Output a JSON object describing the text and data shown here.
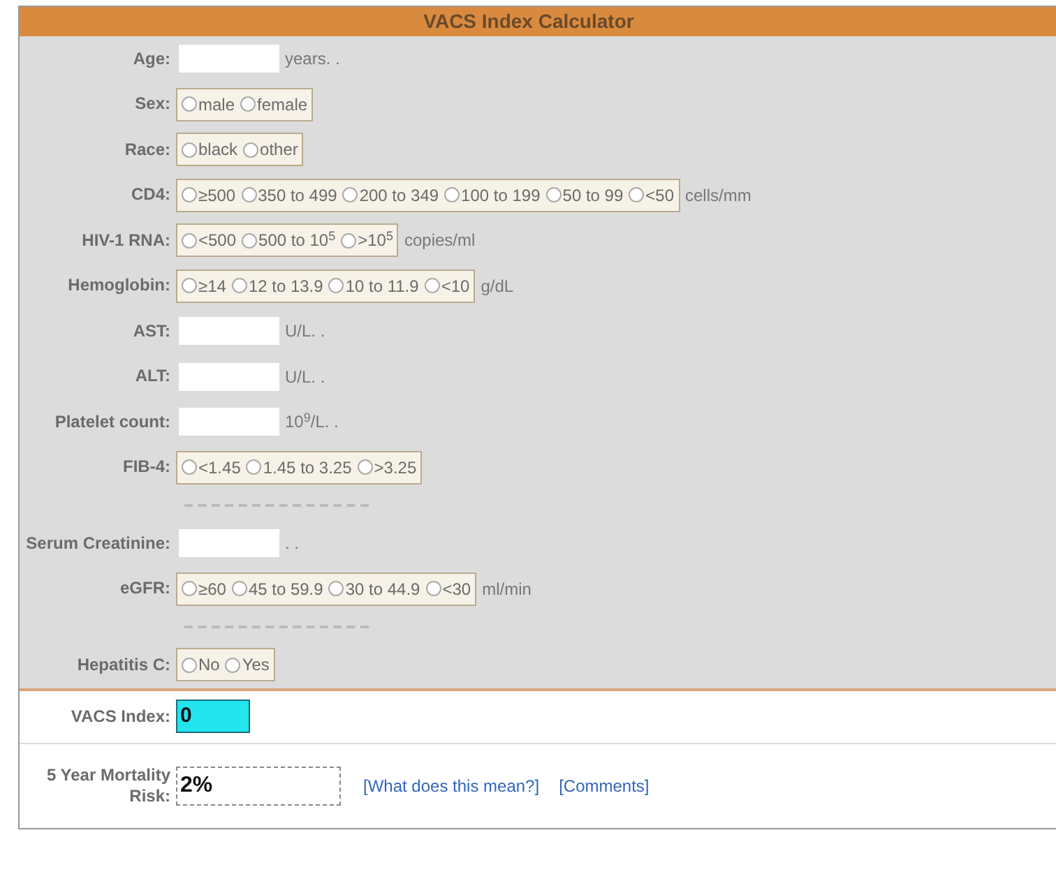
{
  "title": "VACS Index Calculator",
  "fields": [
    {
      "kind": "text",
      "label": "Age:",
      "unit": "years. ."
    },
    {
      "kind": "radio",
      "label": "Sex:",
      "options": [
        {
          "label": "male",
          "checked": false
        },
        {
          "label": "female",
          "checked": false
        }
      ]
    },
    {
      "kind": "radio",
      "label": "Race:",
      "options": [
        {
          "label": "black",
          "checked": false
        },
        {
          "label": "other",
          "checked": false
        }
      ]
    },
    {
      "kind": "radio",
      "label": "CD4:",
      "options": [
        {
          "label": "≥500",
          "checked": false
        },
        {
          "label": "350 to 499",
          "checked": false
        },
        {
          "label": "200 to 349",
          "checked": false
        },
        {
          "label": "100 to 199",
          "checked": false
        },
        {
          "label": "50 to 99",
          "checked": false
        },
        {
          "label": "<50",
          "checked": false
        }
      ],
      "unit": "cells/mm"
    },
    {
      "kind": "radio",
      "label": "HIV-1 RNA:",
      "options": [
        {
          "label": "<500",
          "checked": false
        },
        {
          "label": "500 to 10$^{5}$",
          "checked": false
        },
        {
          "label": ">10$^{5}$",
          "checked": false
        }
      ],
      "unit": "copies/ml"
    },
    {
      "kind": "radio",
      "label": "Hemoglobin:",
      "options": [
        {
          "label": "≥14",
          "checked": false
        },
        {
          "label": "12 to 13.9",
          "checked": false
        },
        {
          "label": "10 to 11.9",
          "checked": false
        },
        {
          "label": "<10",
          "checked": false
        }
      ],
      "unit": "g/dL"
    },
    {
      "kind": "text",
      "label": "AST:",
      "unit": "U/L. ."
    },
    {
      "kind": "text",
      "label": "ALT:",
      "unit": "U/L. ."
    },
    {
      "kind": "text",
      "label": "Platelet count:",
      "unit": "10$^{9}$/L. ."
    },
    {
      "kind": "radio",
      "label": "FIB-4:",
      "options": [
        {
          "label": "<1.45",
          "checked": false
        },
        {
          "label": "1.45 to 3.25",
          "checked": false
        },
        {
          "label": ">3.25",
          "checked": false
        }
      ]
    },
    {
      "kind": "rule"
    },
    {
      "kind": "text",
      "label": "Serum Creatinine:",
      "unit": ". ."
    },
    {
      "kind": "radio",
      "label": "eGFR:",
      "options": [
        {
          "label": "≥60",
          "checked": false
        },
        {
          "label": "45 to 59.9",
          "checked": false
        },
        {
          "label": "30 to 44.9",
          "checked": false
        },
        {
          "label": "<30",
          "checked": false
        }
      ],
      "unit": "ml/min"
    },
    {
      "kind": "rule"
    },
    {
      "kind": "radio",
      "label": "Hepatitis C:",
      "options": [
        {
          "label": "No",
          "checked": false
        },
        {
          "label": "Yes",
          "checked": false
        }
      ]
    }
  ],
  "vacs_index": {
    "label": "VACS Index:",
    "value": "0"
  },
  "mortality": {
    "label": "5 Year Mortality Risk:",
    "value": "2%",
    "links": [
      "[What does this mean?]",
      "[Comments]"
    ]
  }
}
